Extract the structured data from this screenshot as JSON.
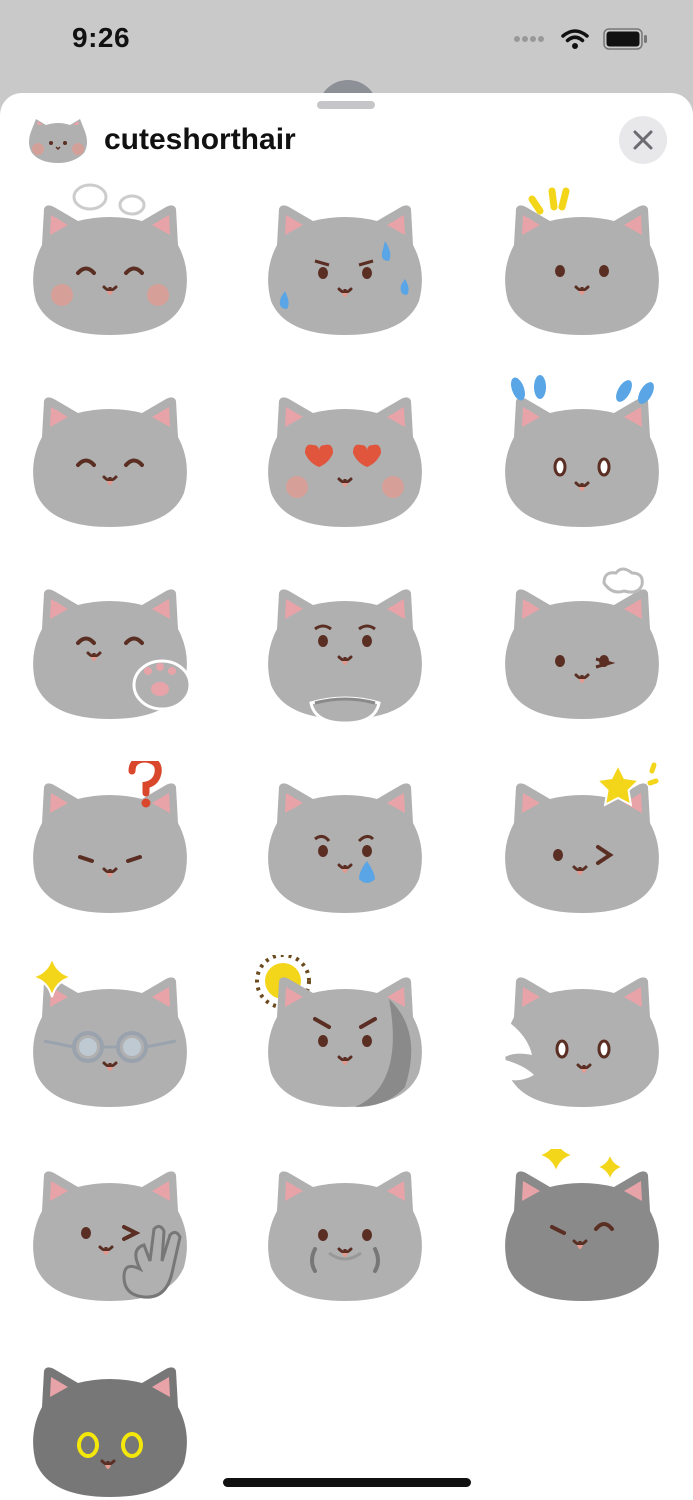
{
  "status_bar": {
    "time": "9:26"
  },
  "sheet": {
    "title": "cuteshorthair",
    "close_label": "close"
  },
  "colors": {
    "fur": "#b0b0b0",
    "fur_dark": "#8a8a8a",
    "ear_inner": "#e8a3a8",
    "eye": "#5a2e22",
    "blush": "#e39a90",
    "tear": "#5aa5e6",
    "heart": "#e0553c",
    "sparkle": "#f3d51a",
    "question": "#d9472c"
  },
  "stickers": [
    {
      "variant": "thought-bubbles-blush"
    },
    {
      "variant": "sweat-drops"
    },
    {
      "variant": "yellow-surprise-lines"
    },
    {
      "variant": "happy-closed-eyes"
    },
    {
      "variant": "heart-eyes"
    },
    {
      "variant": "blue-shock-drops"
    },
    {
      "variant": "paw-wave"
    },
    {
      "variant": "hug-pillow"
    },
    {
      "variant": "thought-cloud"
    },
    {
      "variant": "question-mark"
    },
    {
      "variant": "crying-tear"
    },
    {
      "variant": "star-wink"
    },
    {
      "variant": "glasses-sparkle"
    },
    {
      "variant": "sun-angry"
    },
    {
      "variant": "peeking-surprised"
    },
    {
      "variant": "wink-ok-hand"
    },
    {
      "variant": "shy-paws"
    },
    {
      "variant": "dark-sparkles"
    },
    {
      "variant": "dark-yellow-eyes"
    }
  ]
}
